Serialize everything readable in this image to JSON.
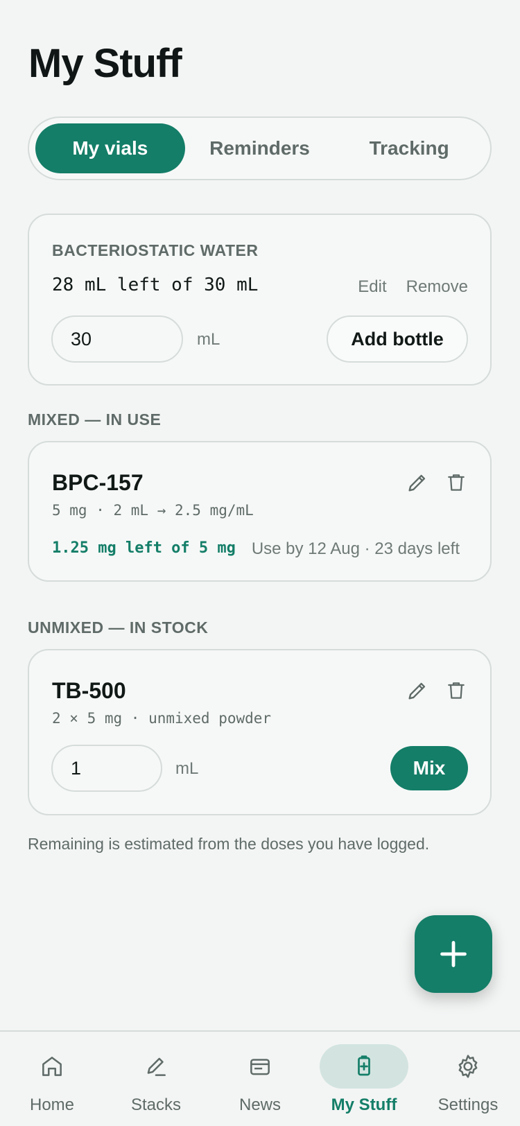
{
  "page": {
    "title": "My Stuff"
  },
  "tabs": [
    {
      "label": "My vials",
      "active": true
    },
    {
      "label": "Reminders",
      "active": false
    },
    {
      "label": "Tracking",
      "active": false
    }
  ],
  "water": {
    "label": "BACTERIOSTATIC WATER",
    "remaining": "28 mL left of 30 mL",
    "edit_label": "Edit",
    "remove_label": "Remove",
    "input_value": "30",
    "unit": "mL",
    "add_bottle_label": "Add bottle"
  },
  "mixed": {
    "section_label": "MIXED — IN USE",
    "name": "BPC-157",
    "spec": "5 mg · 2 mL → 2.5 mg/mL",
    "left": "1.25 mg left of 5 mg",
    "use_by": "Use by 12 Aug · 23 days left"
  },
  "unmixed": {
    "section_label": "UNMIXED — IN STOCK",
    "name": "TB-500",
    "spec": "2 × 5 mg · unmixed powder",
    "input_value": "1",
    "unit": "mL",
    "mix_label": "Mix"
  },
  "footnote": "Remaining is estimated from the doses you have logged.",
  "colors": {
    "accent": "#147e68",
    "background": "#f3f5f4",
    "border": "#d5dcda",
    "active_nav_pill": "#d3e4e0"
  },
  "nav": [
    {
      "label": "Home",
      "icon": "home-icon",
      "active": false
    },
    {
      "label": "Stacks",
      "icon": "pen-icon",
      "active": false
    },
    {
      "label": "News",
      "icon": "news-icon",
      "active": false
    },
    {
      "label": "My Stuff",
      "icon": "vial-icon",
      "active": true
    },
    {
      "label": "Settings",
      "icon": "gear-icon",
      "active": false
    }
  ]
}
